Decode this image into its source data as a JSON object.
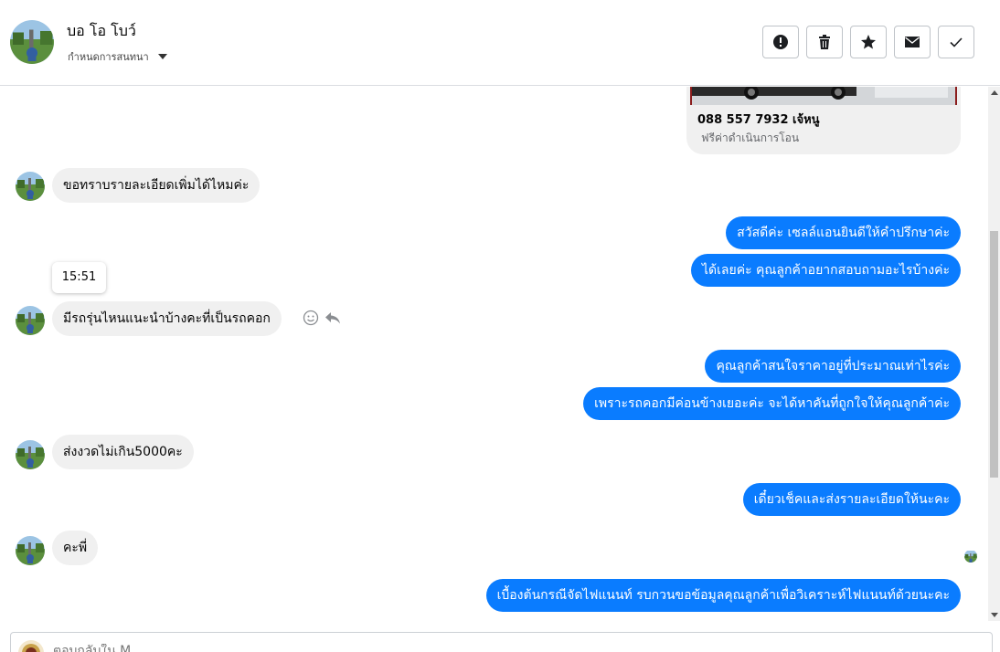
{
  "header": {
    "contact_name": "บอ โอ โบว์",
    "settings_label": "กำหนดการสนทนา",
    "actions": [
      {
        "name": "report-button",
        "icon": "alert-icon"
      },
      {
        "name": "delete-button",
        "icon": "trash-icon"
      },
      {
        "name": "star-button",
        "icon": "star-icon"
      },
      {
        "name": "mark-unread-button",
        "icon": "mail-icon"
      },
      {
        "name": "mark-done-button",
        "icon": "check-icon"
      }
    ]
  },
  "card": {
    "title": "088 557 7932 เจ้หนู",
    "subtitle": "ฟรีค่าดำเนินการโอน"
  },
  "messages": [
    {
      "dir": "in",
      "text": "ขอทราบรายละเอียดเพิ่มได้ไหมค่ะ"
    },
    {
      "dir": "out",
      "text": "สวัสดีค่ะ เซลล์แอนยินดีให้คำปรึกษาค่ะ"
    },
    {
      "dir": "out",
      "text": "ได้เลยค่ะ คุณลูกค้าอยากสอบถามอะไรบ้างค่ะ"
    },
    {
      "dir": "in",
      "text": "มีรถรุ่นไหนแนะนำบ้างคะที่เป็นรถคอก"
    },
    {
      "dir": "out",
      "text": "คุณลูกค้าสนใจราคาอยู่ที่ประมาณเท่าไรค่ะ"
    },
    {
      "dir": "out",
      "text": "เพราะรถคอกมีค่อนข้างเยอะค่ะ จะได้หาคันที่ถูกใจให้คุณลูกค้าค่ะ"
    },
    {
      "dir": "in",
      "text": "ส่งงวดไม่เกิน5000คะ"
    },
    {
      "dir": "out",
      "text": "เดี๋ยวเช็คและส่งรายละเอียดให้นะคะ"
    },
    {
      "dir": "in",
      "text": "คะพี่"
    },
    {
      "dir": "out",
      "text": "เบื้องต้นกรณีจัดไฟแนนท์ รบกวนขอข้อมูลคุณลูกค้าเพื่อวิเคราะห์ไฟแนนท์ด้วยนะคะ"
    }
  ],
  "tooltip": {
    "time": "15:51"
  },
  "composer": {
    "placeholder": "ตอบกลับใน M..."
  },
  "colors": {
    "outgoing_bubble": "#0a7cff",
    "incoming_bubble": "#f0f0f0",
    "border": "#dadde1"
  }
}
